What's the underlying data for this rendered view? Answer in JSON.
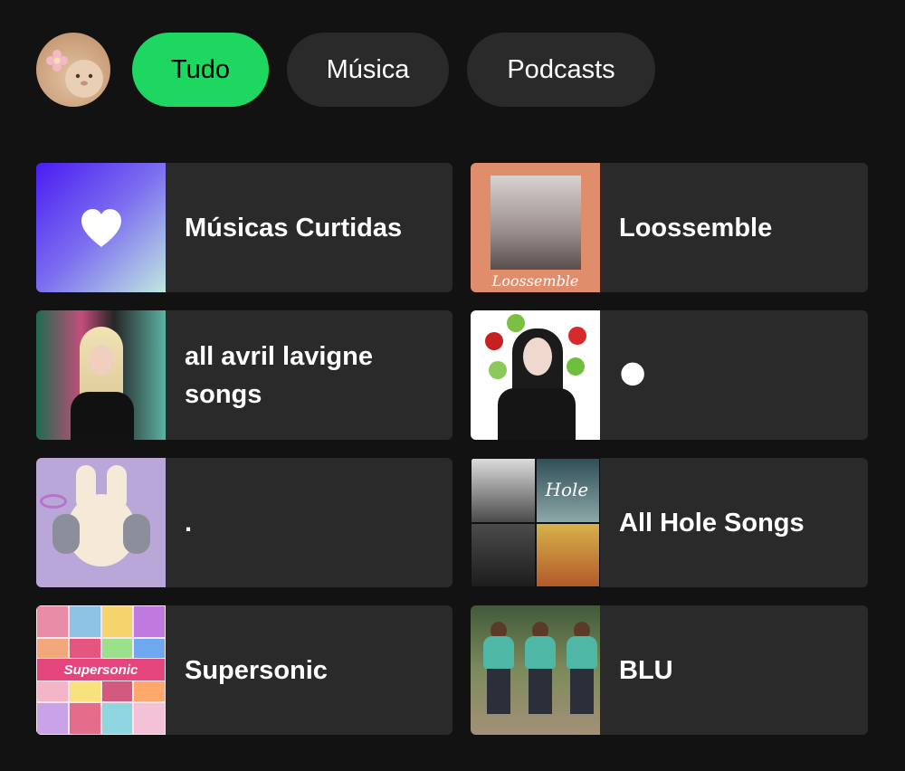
{
  "filters": {
    "chips": [
      {
        "label": "Tudo",
        "active": true
      },
      {
        "label": "Música",
        "active": false
      },
      {
        "label": "Podcasts",
        "active": false
      }
    ]
  },
  "colors": {
    "background": "#121212",
    "card": "#2a2a2a",
    "accent": "#1ed760"
  },
  "library": {
    "items": [
      {
        "title": "Músicas Curtidas",
        "thumb": "heart-icon"
      },
      {
        "title": "Loossemble",
        "thumb_text": "Loossemble"
      },
      {
        "title": "all avril lavigne songs"
      },
      {
        "title": "🌑"
      },
      {
        "title": "."
      },
      {
        "title": "All Hole Songs",
        "thumb_text": "Hole"
      },
      {
        "title": "Supersonic",
        "thumb_text": "Supersonic"
      },
      {
        "title": "BLU"
      }
    ]
  }
}
